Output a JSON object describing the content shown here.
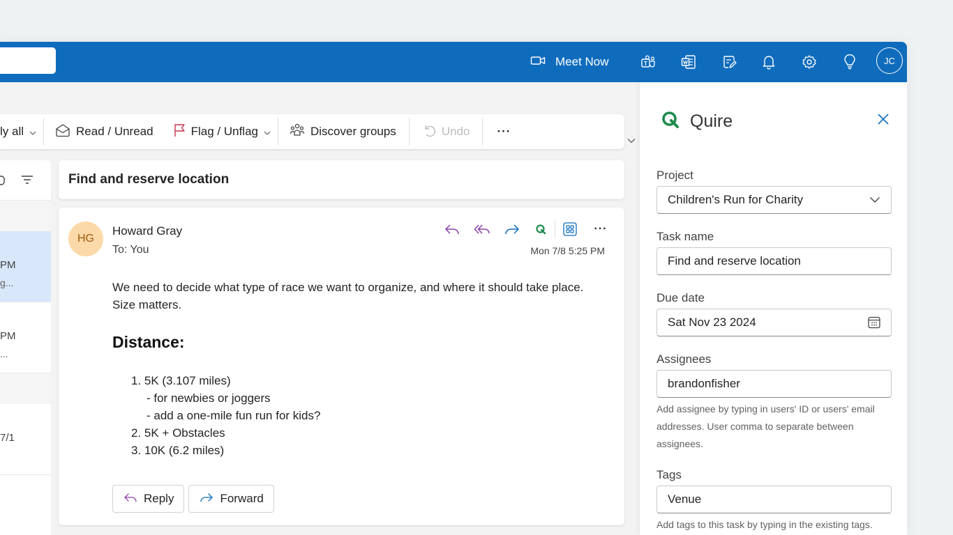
{
  "topbar": {
    "meet_now_label": "Meet Now",
    "user_initials": "JC",
    "icons": [
      "video-camera-icon",
      "teams-icon",
      "word-icon",
      "notes-icon",
      "bell-icon",
      "gear-icon",
      "lightbulb-icon"
    ]
  },
  "toolbar": {
    "reply_all_label": "ly all",
    "read_unread_label": "Read / Unread",
    "flag_label": "Flag / Unflag",
    "discover_groups_label": "Discover groups",
    "undo_label": "Undo",
    "more_label": "···"
  },
  "message_list": {
    "items": [
      {
        "time": "PM",
        "preview": "g..."
      },
      {
        "time": "PM",
        "preview": "..."
      },
      {
        "time": "7/1",
        "preview": ""
      }
    ]
  },
  "message": {
    "subject": "Find and reserve location",
    "sender_initials": "HG",
    "sender_name": "Howard Gray",
    "to_line": "To:  You",
    "date": "Mon 7/8 5:25 PM",
    "body": "We need to decide what type of race we want to organize, and where it should take place. Size matters.",
    "heading": "Distance:",
    "list": [
      "1. 5K (3.107 miles)",
      "- for newbies or joggers",
      "- add a one-mile fun run for kids?",
      "2. 5K + Obstacles",
      "3. 10K (6.2 miles)"
    ],
    "reply_label": "Reply",
    "forward_label": "Forward",
    "more_label": "···"
  },
  "quire": {
    "title": "Quire",
    "project_label": "Project",
    "project_value": "Children's Run for Charity",
    "task_name_label": "Task name",
    "task_name_value": "Find and reserve location",
    "due_date_label": "Due date",
    "due_date_value": "Sat Nov 23 2024",
    "assignees_label": "Assignees",
    "assignees_value": "brandonfisher",
    "assignees_hint": "Add assignee by typing in users' ID or users' email addresses. User comma to separate between assignees.",
    "tags_label": "Tags",
    "tags_value": "Venue",
    "tags_hint": "Add tags to this task by typing in the existing tags."
  },
  "colors": {
    "brand_blue": "#0f6cbd",
    "quire_green": "#1e8a4c",
    "reply_purple": "#8b3fa8",
    "selected_row": "#d8e7fa"
  }
}
